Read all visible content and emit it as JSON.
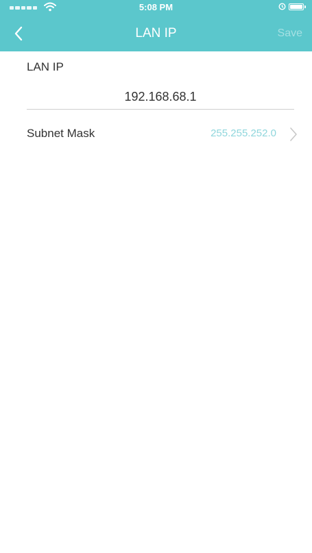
{
  "status_bar": {
    "time": "5:08 PM"
  },
  "nav": {
    "title": "LAN IP",
    "save_label": "Save"
  },
  "lan_ip": {
    "label": "LAN IP",
    "value": "192.168.68.1"
  },
  "subnet": {
    "label": "Subnet Mask",
    "value": "255.255.252.0"
  },
  "colors": {
    "header": "#5bc7cc",
    "accent_value": "#8fd6dc",
    "text": "#333333"
  },
  "icons": {
    "back": "chevron-left-icon",
    "row_arrow": "chevron-right-icon",
    "wifi": "wifi-icon",
    "battery": "battery-icon",
    "alarm": "alarm-icon"
  }
}
